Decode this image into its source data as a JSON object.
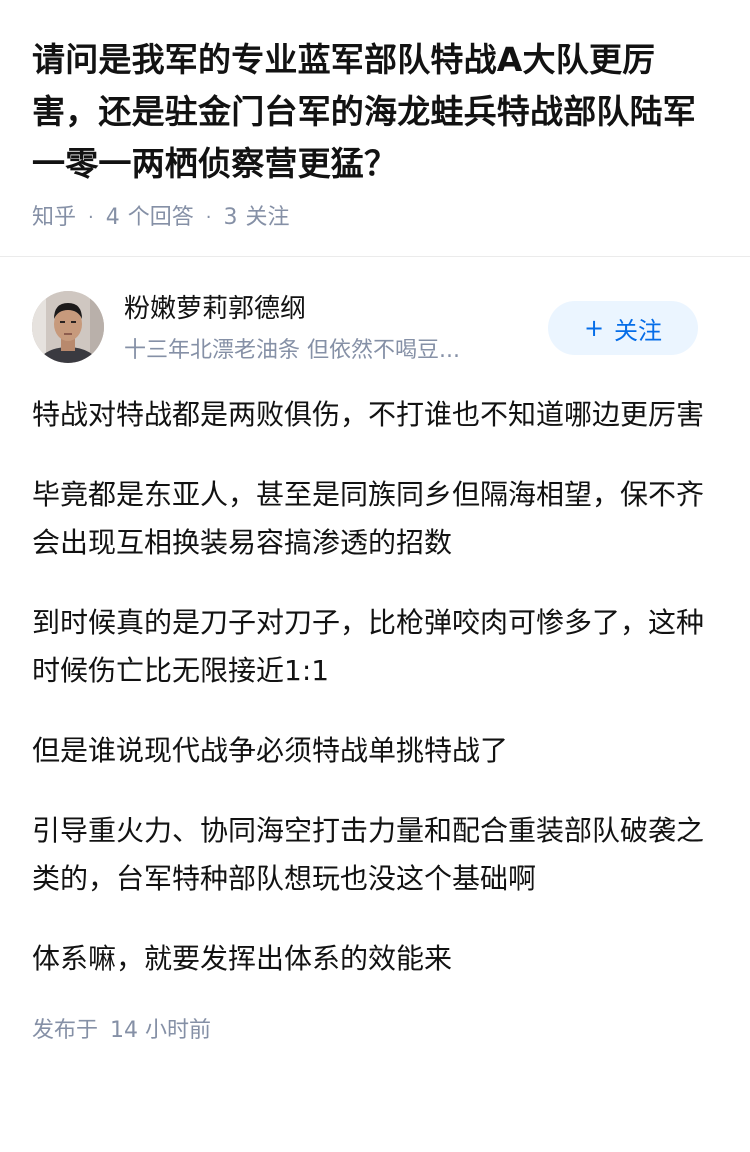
{
  "question": {
    "title": "请问是我军的专业蓝军部队特战A大队更厉害，还是驻金门台军的海龙蛙兵特战部队陆军一零一两栖侦察营更猛？",
    "source": "知乎",
    "answer_count": "4",
    "answer_label": "个回答",
    "follow_count": "3",
    "follow_label": "关注"
  },
  "author": {
    "name": "粉嫩萝莉郭德纲",
    "bio": "十三年北漂老油条 但依然不喝豆...",
    "follow_button": "关注",
    "follow_icon": "plus-icon"
  },
  "answer": {
    "paragraphs": [
      "特战对特战都是两败俱伤，不打谁也不知道哪边更厉害",
      "毕竟都是东亚人，甚至是同族同乡但隔海相望，保不齐会出现互相换装易容搞渗透的招数",
      "到时候真的是刀子对刀子，比枪弹咬肉可惨多了，这种时候伤亡比无限接近1:1",
      "但是谁说现代战争必须特战单挑特战了",
      "引导重火力、协同海空打击力量和配合重装部队破袭之类的，台军特种部队想玩也没这个基础啊",
      "体系嘛，就要发挥出体系的效能来"
    ],
    "published_label": "发布于",
    "published_time": "14 小时前"
  },
  "colors": {
    "accent": "#056de8",
    "accent_bg": "#ebf5ff",
    "muted": "#8590a6",
    "text": "#121212"
  }
}
